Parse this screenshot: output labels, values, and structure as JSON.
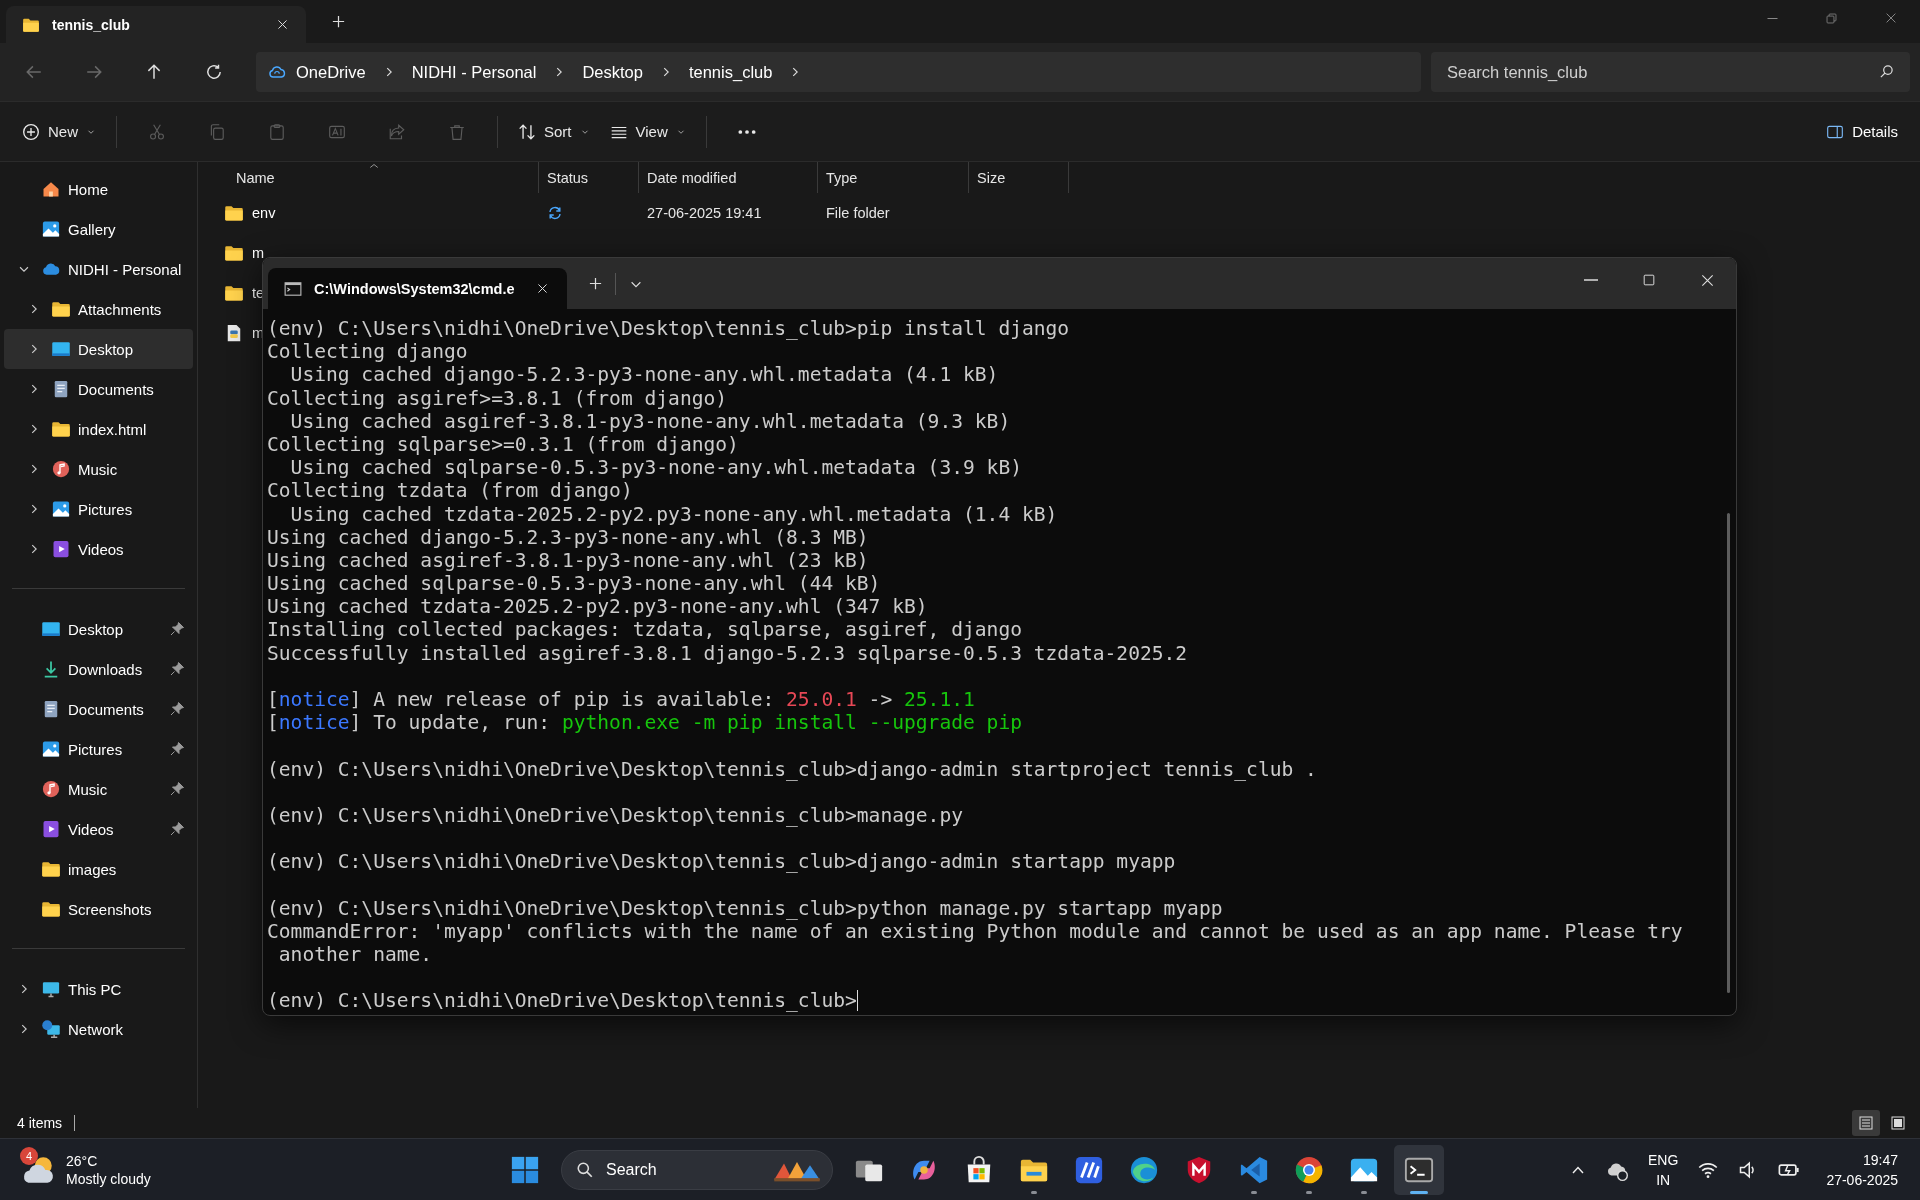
{
  "explorer": {
    "tab": {
      "title": "tennis_club"
    },
    "nav": [
      {
        "kind": "back",
        "disabled": true
      },
      {
        "kind": "forward",
        "disabled": true
      },
      {
        "kind": "up",
        "disabled": false
      },
      {
        "kind": "refresh",
        "disabled": false
      }
    ],
    "breadcrumb": [
      {
        "label": "OneDrive"
      },
      {
        "label": "NIDHI - Personal"
      },
      {
        "label": "Desktop"
      },
      {
        "label": "tennis_club"
      }
    ],
    "search": {
      "placeholder": "Search tennis_club"
    },
    "toolbar": [
      {
        "kind": "new",
        "label": "New",
        "disabled": false
      },
      {
        "kind": "cut",
        "disabled": true
      },
      {
        "kind": "copy",
        "disabled": true
      },
      {
        "kind": "paste",
        "disabled": true
      },
      {
        "kind": "rename",
        "disabled": true
      },
      {
        "kind": "share",
        "disabled": true
      },
      {
        "kind": "delete",
        "disabled": true
      },
      {
        "kind": "sort",
        "label": "Sort",
        "disabled": false
      },
      {
        "kind": "view",
        "label": "View",
        "disabled": false
      },
      {
        "kind": "more",
        "disabled": false
      }
    ],
    "details_button": {
      "label": "Details"
    },
    "sidebar": {
      "sections": [
        [
          {
            "label": "Home",
            "kind": "home",
            "selected": false
          },
          {
            "label": "Gallery",
            "kind": "gallery",
            "selected": false
          },
          {
            "label": "NIDHI - Personal",
            "kind": "cloud",
            "selected": false,
            "expanded": true,
            "children": [
              {
                "label": "Attachments",
                "kind": "folder",
                "selected": false,
                "expanded": false
              },
              {
                "label": "Desktop",
                "kind": "desktop",
                "selected": true,
                "expanded": false
              },
              {
                "label": "Documents",
                "kind": "documents",
                "selected": false,
                "expanded": false
              },
              {
                "label": "index.html",
                "kind": "folder",
                "selected": false,
                "expanded": false
              },
              {
                "label": "Music",
                "kind": "music",
                "selected": false,
                "expanded": false
              },
              {
                "label": "Pictures",
                "kind": "pictures",
                "selected": false,
                "expanded": false
              },
              {
                "label": "Videos",
                "kind": "videos",
                "selected": false,
                "expanded": false
              }
            ]
          }
        ],
        [
          {
            "label": "Desktop",
            "kind": "desktop",
            "selected": false,
            "pinned": true
          },
          {
            "label": "Downloads",
            "kind": "downloads",
            "selected": false,
            "pinned": true
          },
          {
            "label": "Documents",
            "kind": "documents",
            "selected": false,
            "pinned": true
          },
          {
            "label": "Pictures",
            "kind": "pictures",
            "selected": false,
            "pinned": true
          },
          {
            "label": "Music",
            "kind": "music",
            "selected": false,
            "pinned": true
          },
          {
            "label": "Videos",
            "kind": "videos",
            "selected": false,
            "pinned": true
          },
          {
            "label": "images",
            "kind": "folder",
            "selected": false,
            "pinned": false
          },
          {
            "label": "Screenshots",
            "kind": "folder",
            "selected": false,
            "pinned": false
          }
        ],
        [
          {
            "label": "This PC",
            "kind": "pc",
            "selected": false,
            "expanded": false
          },
          {
            "label": "Network",
            "kind": "network",
            "selected": false,
            "expanded": false
          }
        ]
      ]
    },
    "columns": [
      {
        "label": "Name",
        "sorted": true
      },
      {
        "label": "Status",
        "sorted": false
      },
      {
        "label": "Date modified",
        "sorted": false
      },
      {
        "label": "Type",
        "sorted": false
      },
      {
        "label": "Size",
        "sorted": false
      }
    ],
    "files": [
      {
        "name": "env",
        "kind": "folder",
        "syncing": true,
        "date": "27-06-2025 19:41",
        "type": "File folder"
      },
      {
        "name": "m",
        "kind": "folder"
      },
      {
        "name": "te",
        "kind": "folder"
      },
      {
        "name": "m",
        "kind": "python"
      }
    ],
    "status_bar": {
      "count": "4 items",
      "views": [
        {
          "kind": "details",
          "selected": true
        },
        {
          "kind": "tiles",
          "selected": false
        }
      ]
    }
  },
  "terminal": {
    "tab": {
      "title": "C:\\Windows\\System32\\cmd.e"
    },
    "cursor": true,
    "blocks": [
      {
        "lines": [
          {
            "segments": [
              {
                "text": "(env) C:\\Users\\nidhi\\OneDrive\\Desktop\\tennis_club>pip install django",
                "color": "#cccccc"
              }
            ]
          },
          {
            "segments": [
              {
                "text": "Collecting django",
                "color": "#cccccc"
              }
            ]
          },
          {
            "segments": [
              {
                "text": "  Using cached django-5.2.3-py3-none-any.whl.metadata (4.1 kB)",
                "color": "#cccccc"
              }
            ]
          },
          {
            "segments": [
              {
                "text": "Collecting asgiref>=3.8.1 (from django)",
                "color": "#cccccc"
              }
            ]
          },
          {
            "segments": [
              {
                "text": "  Using cached asgiref-3.8.1-py3-none-any.whl.metadata (9.3 kB)",
                "color": "#cccccc"
              }
            ]
          },
          {
            "segments": [
              {
                "text": "Collecting sqlparse>=0.3.1 (from django)",
                "color": "#cccccc"
              }
            ]
          },
          {
            "segments": [
              {
                "text": "  Using cached sqlparse-0.5.3-py3-none-any.whl.metadata (3.9 kB)",
                "color": "#cccccc"
              }
            ]
          },
          {
            "segments": [
              {
                "text": "Collecting tzdata (from django)",
                "color": "#cccccc"
              }
            ]
          },
          {
            "segments": [
              {
                "text": "  Using cached tzdata-2025.2-py2.py3-none-any.whl.metadata (1.4 kB)",
                "color": "#cccccc"
              }
            ]
          },
          {
            "segments": [
              {
                "text": "Using cached django-5.2.3-py3-none-any.whl (8.3 MB)",
                "color": "#cccccc"
              }
            ]
          },
          {
            "segments": [
              {
                "text": "Using cached asgiref-3.8.1-py3-none-any.whl (23 kB)",
                "color": "#cccccc"
              }
            ]
          },
          {
            "segments": [
              {
                "text": "Using cached sqlparse-0.5.3-py3-none-any.whl (44 kB)",
                "color": "#cccccc"
              }
            ]
          },
          {
            "segments": [
              {
                "text": "Using cached tzdata-2025.2-py2.py3-none-any.whl (347 kB)",
                "color": "#cccccc"
              }
            ]
          },
          {
            "segments": [
              {
                "text": "Installing collected packages: tzdata, sqlparse, asgiref, django",
                "color": "#cccccc"
              }
            ]
          },
          {
            "segments": [
              {
                "text": "Successfully installed asgiref-3.8.1 django-5.2.3 sqlparse-0.5.3 tzdata-2025.2",
                "color": "#cccccc"
              }
            ]
          }
        ]
      },
      {
        "lines": [
          {
            "segments": [
              {
                "text": "[",
                "color": "#cccccc"
              },
              {
                "text": "notice",
                "color": "#3b78ff"
              },
              {
                "text": "] A new release of pip is available: ",
                "color": "#cccccc"
              },
              {
                "text": "25.0.1",
                "color": "#e74856"
              },
              {
                "text": " -> ",
                "color": "#cccccc"
              },
              {
                "text": "25.1.1",
                "color": "#16c60c"
              }
            ]
          },
          {
            "segments": [
              {
                "text": "[",
                "color": "#cccccc"
              },
              {
                "text": "notice",
                "color": "#3b78ff"
              },
              {
                "text": "] To update, run: ",
                "color": "#cccccc"
              },
              {
                "text": "python.exe -m pip install --upgrade pip",
                "color": "#16c60c"
              }
            ]
          }
        ]
      },
      {
        "lines": [
          {
            "segments": [
              {
                "text": "(env) C:\\Users\\nidhi\\OneDrive\\Desktop\\tennis_club>django-admin startproject tennis_club .",
                "color": "#cccccc"
              }
            ]
          }
        ]
      },
      {
        "lines": [
          {
            "segments": [
              {
                "text": "(env) C:\\Users\\nidhi\\OneDrive\\Desktop\\tennis_club>manage.py",
                "color": "#cccccc"
              }
            ]
          }
        ]
      },
      {
        "lines": [
          {
            "segments": [
              {
                "text": "(env) C:\\Users\\nidhi\\OneDrive\\Desktop\\tennis_club>django-admin startapp myapp",
                "color": "#cccccc"
              }
            ]
          }
        ]
      },
      {
        "lines": [
          {
            "segments": [
              {
                "text": "(env) C:\\Users\\nidhi\\OneDrive\\Desktop\\tennis_club>python manage.py startapp myapp",
                "color": "#cccccc"
              }
            ]
          },
          {
            "segments": [
              {
                "text": "CommandError: 'myapp' conflicts with the name of an existing Python module and cannot be used as an app name. Please try",
                "color": "#cccccc"
              }
            ]
          },
          {
            "segments": [
              {
                "text": " another name.",
                "color": "#cccccc"
              }
            ]
          }
        ]
      },
      {
        "lines": [
          {
            "segments": [
              {
                "text": "(env) C:\\Users\\nidhi\\OneDrive\\Desktop\\tennis_club>",
                "color": "#cccccc"
              }
            ]
          }
        ]
      }
    ]
  },
  "taskbar": {
    "weather": {
      "badge": "4",
      "temperature": "26°C",
      "condition": "Mostly cloudy"
    },
    "search": {
      "label": "Search"
    },
    "apps": [
      {
        "kind": "taskview",
        "running": false,
        "selected": false
      },
      {
        "kind": "copilot",
        "running": false,
        "selected": false
      },
      {
        "kind": "store",
        "running": false,
        "selected": false
      },
      {
        "kind": "explorer",
        "running": true,
        "selected": false
      },
      {
        "kind": "stripes",
        "running": false,
        "selected": false
      },
      {
        "kind": "edge",
        "running": false,
        "selected": false
      },
      {
        "kind": "shield",
        "running": false,
        "selected": false
      },
      {
        "kind": "vscode",
        "running": true,
        "selected": false
      },
      {
        "kind": "chrome",
        "running": true,
        "selected": false
      },
      {
        "kind": "photos",
        "running": true,
        "selected": false
      },
      {
        "kind": "terminal",
        "running": true,
        "selected": true
      }
    ],
    "language": {
      "code": "ENG",
      "region": "IN"
    },
    "clock": {
      "time": "19:47",
      "date": "27-06-2025"
    }
  }
}
